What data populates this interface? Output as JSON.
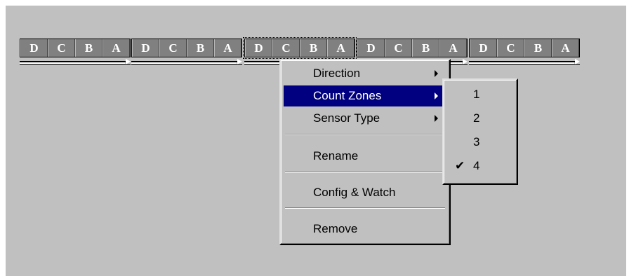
{
  "sensors": [
    {
      "zones": [
        "D",
        "C",
        "B",
        "A"
      ],
      "selected": false
    },
    {
      "zones": [
        "D",
        "C",
        "B",
        "A"
      ],
      "selected": false
    },
    {
      "zones": [
        "D",
        "C",
        "B",
        "A"
      ],
      "selected": true
    },
    {
      "zones": [
        "D",
        "C",
        "B",
        "A"
      ],
      "selected": false
    },
    {
      "zones": [
        "D",
        "C",
        "B",
        "A"
      ],
      "selected": false
    }
  ],
  "context_menu": {
    "items": [
      {
        "label": "Direction",
        "submenu": true
      },
      {
        "label": "Count Zones",
        "submenu": true,
        "highlighted": true
      },
      {
        "label": "Sensor Type",
        "submenu": true
      },
      {
        "label": "Rename"
      },
      {
        "label": "Config & Watch"
      },
      {
        "label": "Remove"
      }
    ]
  },
  "count_zones_submenu": {
    "items": [
      {
        "label": "1",
        "checked": false
      },
      {
        "label": "2",
        "checked": false
      },
      {
        "label": "3",
        "checked": false
      },
      {
        "label": "4",
        "checked": true
      }
    ],
    "check_glyph": "✔"
  },
  "colors": {
    "background": "#c0c0c0",
    "highlight": "#000080",
    "zone_fill": "#808080"
  }
}
